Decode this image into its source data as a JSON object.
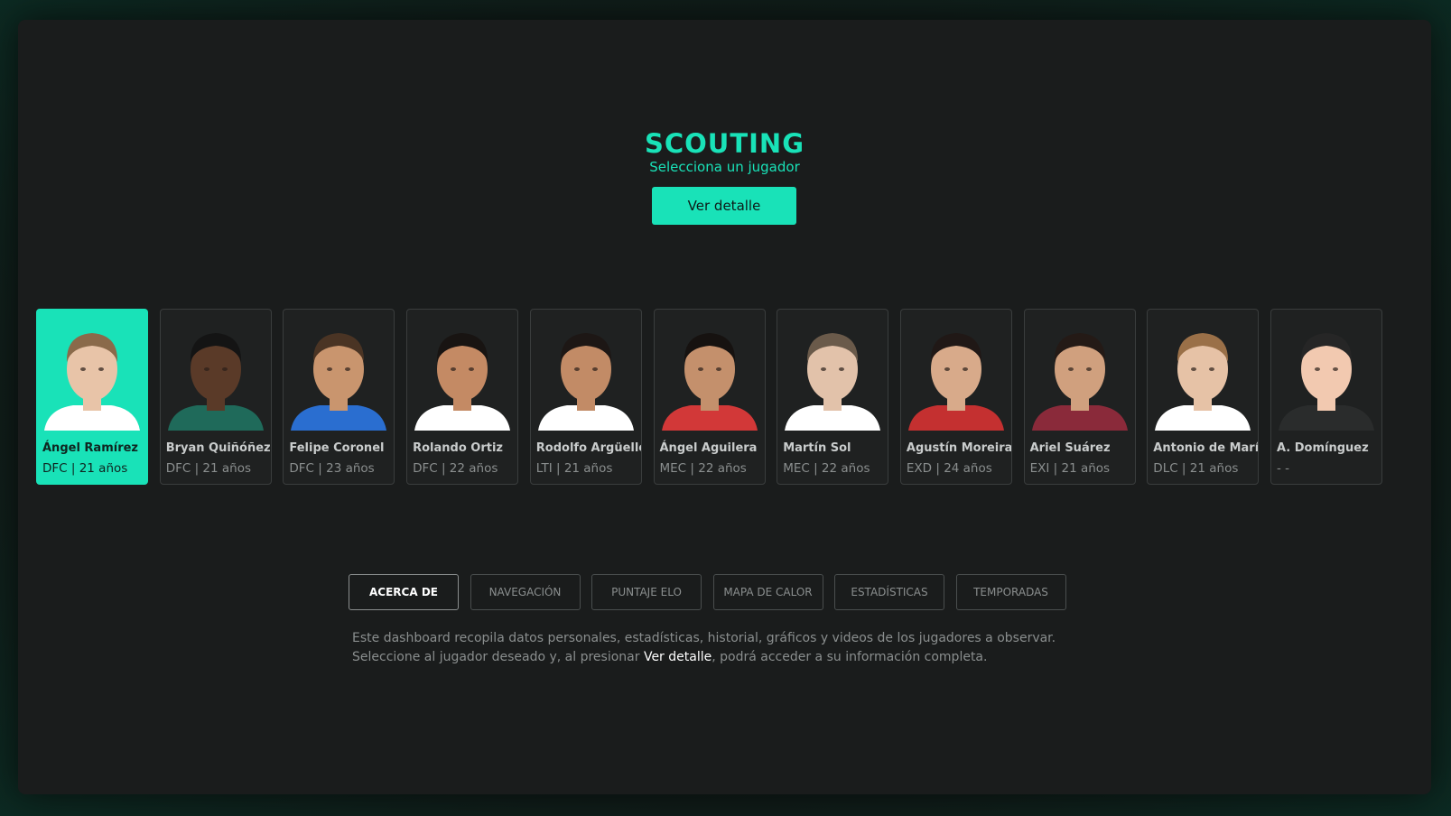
{
  "header": {
    "title": "SCOUTING",
    "subtitle": "Selecciona un jugador",
    "detail_button": "Ver detalle"
  },
  "colors": {
    "accent": "#19e2b8",
    "panel": "#1a1c1c",
    "card": "#1f2121"
  },
  "players": [
    {
      "name": "Ángel Ramírez",
      "meta": "DFC | 21 años",
      "selected": true,
      "skin": "#e8c4a8",
      "hair": "#8a6a4a",
      "shirt": "#ffffff"
    },
    {
      "name": "Bryan Quiñóñez",
      "meta": "DFC | 21 años",
      "selected": false,
      "skin": "#5a3a28",
      "hair": "#141414",
      "shirt": "#1f6a5a"
    },
    {
      "name": "Felipe Coronel",
      "meta": "DFC | 23 años",
      "selected": false,
      "skin": "#c9956e",
      "hair": "#4a3424",
      "shirt": "#2a6ed0"
    },
    {
      "name": "Rolando Ortiz",
      "meta": "DFC | 22 años",
      "selected": false,
      "skin": "#c48a64",
      "hair": "#181412",
      "shirt": "#ffffff"
    },
    {
      "name": "Rodolfo Argüello",
      "meta": "LTI | 21 años",
      "selected": false,
      "skin": "#c28b66",
      "hair": "#1d1715",
      "shirt": "#ffffff"
    },
    {
      "name": "Ángel Aguilera",
      "meta": "MEC | 22 años",
      "selected": false,
      "skin": "#c4906c",
      "hair": "#161210",
      "shirt": "#d23838"
    },
    {
      "name": "Martín Sol",
      "meta": "MEC | 22 años",
      "selected": false,
      "skin": "#e2c2aa",
      "hair": "#6a5a4a",
      "shirt": "#ffffff"
    },
    {
      "name": "Agustín Moreira",
      "meta": "EXD | 24 años",
      "selected": false,
      "skin": "#d8aa8a",
      "hair": "#201816",
      "shirt": "#c43030"
    },
    {
      "name": "Ariel Suárez",
      "meta": "EXI | 21 años",
      "selected": false,
      "skin": "#d0a07e",
      "hair": "#241a16",
      "shirt": "#8a2a3a"
    },
    {
      "name": "Antonio de María",
      "meta": "DLC | 21 años",
      "selected": false,
      "skin": "#e6c2a6",
      "hair": "#9a7048",
      "shirt": "#ffffff"
    },
    {
      "name": "A. Domínguez",
      "meta": "- -",
      "selected": false,
      "skin": "#f2c9b0",
      "hair": "#262626",
      "shirt": "#2a2c2c"
    }
  ],
  "tabs": [
    {
      "label": "ACERCA DE",
      "active": true
    },
    {
      "label": "NAVEGACIÓN",
      "active": false
    },
    {
      "label": "PUNTAJE ELO",
      "active": false
    },
    {
      "label": "MAPA DE CALOR",
      "active": false
    },
    {
      "label": "ESTADÍSTICAS",
      "active": false
    },
    {
      "label": "TEMPORADAS",
      "active": false
    }
  ],
  "description": {
    "before": "Este dashboard recopila datos personales, estadísticas, historial, gráficos y videos de los jugadores a observar. Seleccione al jugador deseado y, al presionar ",
    "highlight": "Ver detalle",
    "after": ", podrá acceder a su información completa."
  }
}
